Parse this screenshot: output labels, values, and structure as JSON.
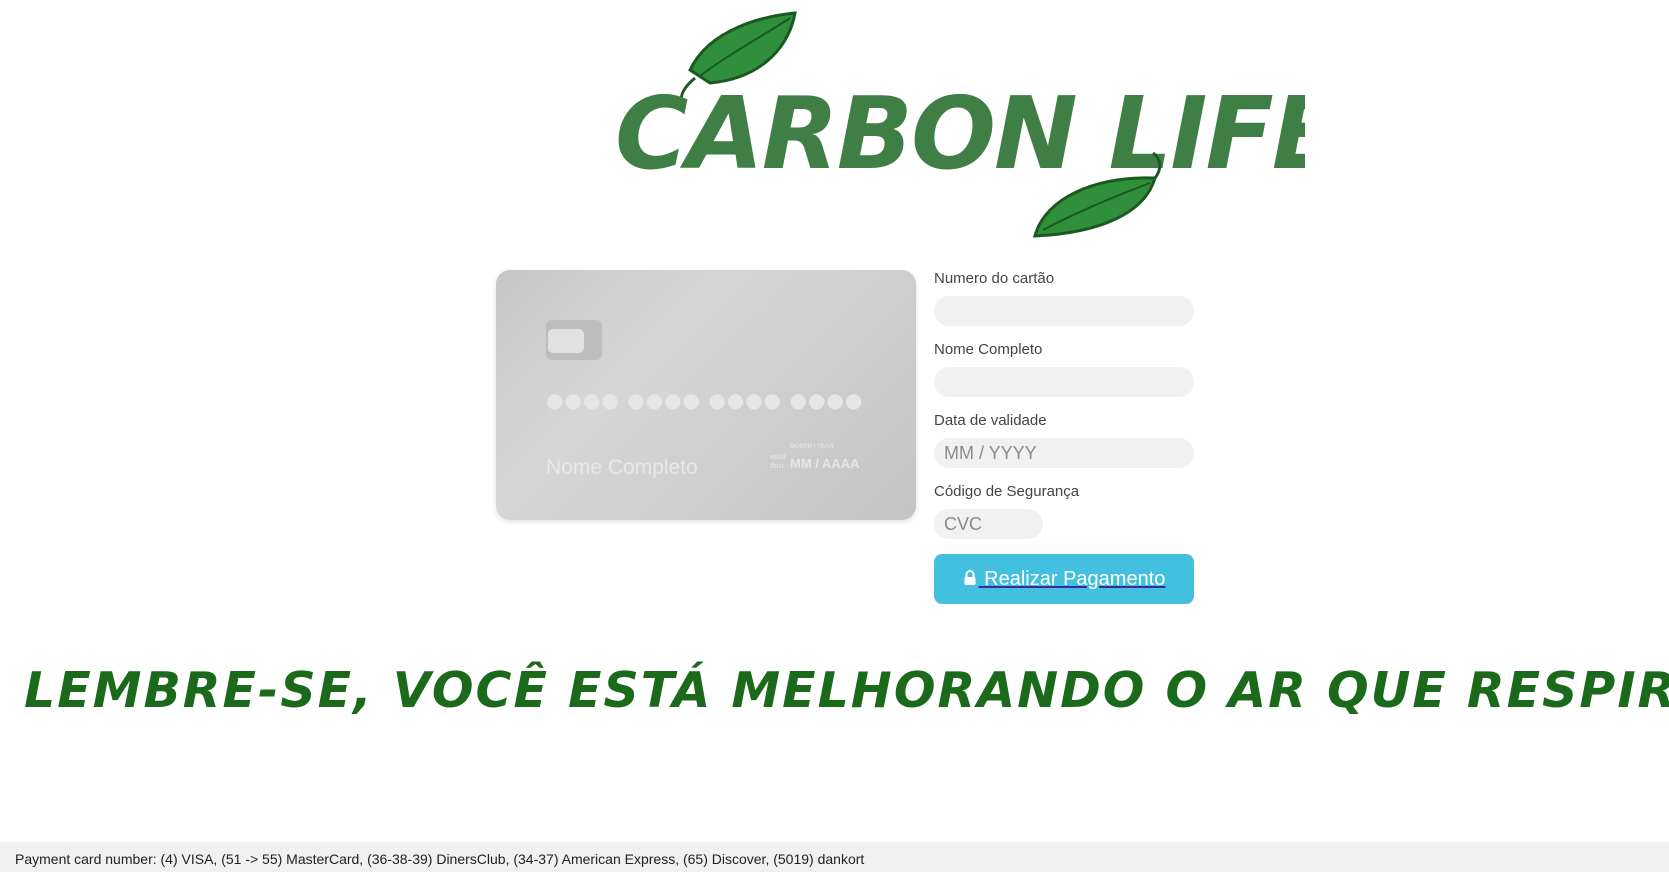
{
  "logo": {
    "text": "CARBON LIFE"
  },
  "card": {
    "number_mask": "●●●● ●●●● ●●●● ●●●●",
    "name": "Nome Completo",
    "valid_label": "valid thru",
    "month_year_label": "MONTH / YEAR",
    "expiry": "MM / AAAA"
  },
  "form": {
    "card_number_label": "Numero do cartão",
    "card_number_value": "",
    "name_label": "Nome Completo",
    "name_value": "",
    "expiry_label": "Data de validade",
    "expiry_placeholder": "MM / YYYY",
    "cvc_label": "Código de Segurança",
    "cvc_placeholder": "CVC",
    "pay_button_label": " Realizar Pagamento"
  },
  "slogan": "LEMBRE-SE, VOCÊ ESTÁ MELHORANDO O AR QUE RESPIRA.",
  "footer": "Payment card number: (4) VISA, (51 -> 55) MasterCard, (36-38-39) DinersClub, (34-37) American Express, (65) Discover, (5019) dankort",
  "colors": {
    "brand_green": "#3f7f45",
    "slogan_green": "#1b6a1b",
    "button": "#43bfdf",
    "card": "#cccccc"
  },
  "icons": [
    "leaf-icon",
    "lock-icon"
  ]
}
